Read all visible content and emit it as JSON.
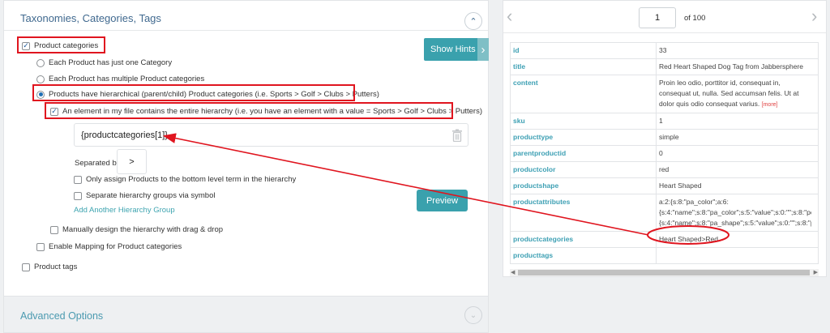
{
  "section": {
    "title": "Taxonomies, Categories, Tags"
  },
  "options": {
    "product_categories": "Product categories",
    "one_category": "Each Product has just one Category",
    "multiple_categories": "Each Product has multiple Product categories",
    "hierarchical": "Products have hierarchical (parent/child) Product categories (i.e. Sports > Golf > Clubs > Putters)",
    "entire_hierarchy": "An element in my file contains the entire hierarchy (i.e. you have an element with a value = Sports > Golf > Clubs > Putters)",
    "bottom_level": "Only assign Products to the bottom level term in the hierarchy",
    "separate_groups": "Separate hierarchy groups via symbol",
    "add_group": "Add Another Hierarchy Group",
    "drag_drop": "Manually design the hierarchy with drag & drop",
    "enable_mapping": "Enable Mapping for Product categories",
    "product_tags": "Product tags"
  },
  "hierarchy_input": {
    "value": "{productcategories[1]}"
  },
  "separator": {
    "label": "Separated by",
    "value": ">"
  },
  "buttons": {
    "show_hints": "Show Hints",
    "preview": "Preview"
  },
  "advanced": {
    "title": "Advanced Options"
  },
  "pager": {
    "current": "1",
    "of_label": "of 100"
  },
  "record": [
    {
      "key": "id",
      "value": "33"
    },
    {
      "key": "title",
      "value": "Red Heart Shaped Dog Tag from Jabbersphere"
    },
    {
      "key": "content",
      "lines": [
        "Proin leo odio, porttitor id, consequat in,",
        "consequat ut, nulla. Sed accumsan felis. Ut at",
        "dolor quis odio consequat varius."
      ],
      "more": "[more]"
    },
    {
      "key": "sku",
      "value": "1"
    },
    {
      "key": "producttype",
      "value": "simple"
    },
    {
      "key": "parentproductid",
      "value": "0"
    },
    {
      "key": "productcolor",
      "value": "red"
    },
    {
      "key": "productshape",
      "value": "Heart Shaped"
    },
    {
      "key": "productattributes",
      "lines": [
        "a:2:{s:8:\"pa_color\";a:6:",
        "{s:4:\"name\";s:8:\"pa_color\";s:5:\"value\";s:0:\"\";s:8:\"pc",
        "{s:4:\"name\";s:8:\"pa_shape\";s:5:\"value\";s:0:\"\";s:8:\"p"
      ]
    },
    {
      "key": "productcategories",
      "value": "Heart Shaped>Red"
    },
    {
      "key": "producttags",
      "value": ""
    }
  ],
  "colors": {
    "accent": "#3aa1ad",
    "title": "#40698f",
    "field_key": "#3ea0b4",
    "annotation": "#e0151f"
  },
  "icons": [
    "chevron-up-icon",
    "chevron-right-icon",
    "trash-icon",
    "chevron-down-icon",
    "chevron-left-icon",
    "check-icon"
  ]
}
